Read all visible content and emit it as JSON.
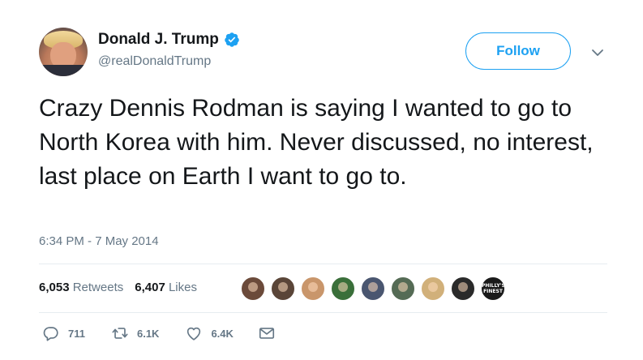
{
  "user": {
    "display_name": "Donald J. Trump",
    "handle": "@realDonaldTrump",
    "verified": true
  },
  "follow_label": "Follow",
  "tweet": {
    "text": "Crazy Dennis Rodman is saying I wanted to go to North Korea with him. Never discussed, no interest, last place on Earth I want to go to.",
    "timestamp": "6:34 PM - 7 May 2014"
  },
  "stats": {
    "retweets_count": "6,053",
    "retweets_label": "Retweets",
    "likes_count": "6,407",
    "likes_label": "Likes"
  },
  "likers": [
    {
      "color": "#6b4a3a"
    },
    {
      "color": "#5a4538"
    },
    {
      "color": "#c9966b"
    },
    {
      "color": "#3a6f3a"
    },
    {
      "color": "#4a5670"
    },
    {
      "color": "#556b55"
    },
    {
      "color": "#d1b07a"
    },
    {
      "color": "#2a2a2a"
    },
    {
      "color": "#1a1a1a",
      "badge_text": "PHILLY'S FINEST"
    }
  ],
  "actions": {
    "replies": "711",
    "retweets": "6.1K",
    "likes": "6.4K"
  },
  "colors": {
    "accent": "#1da1f2",
    "text": "#14171a",
    "muted": "#657786",
    "divider": "#e6ecf0"
  },
  "icons": {
    "verified": "verified-badge-icon",
    "caret": "chevron-down-icon",
    "reply": "reply-icon",
    "retweet": "retweet-icon",
    "like": "heart-icon",
    "dm": "envelope-icon"
  }
}
